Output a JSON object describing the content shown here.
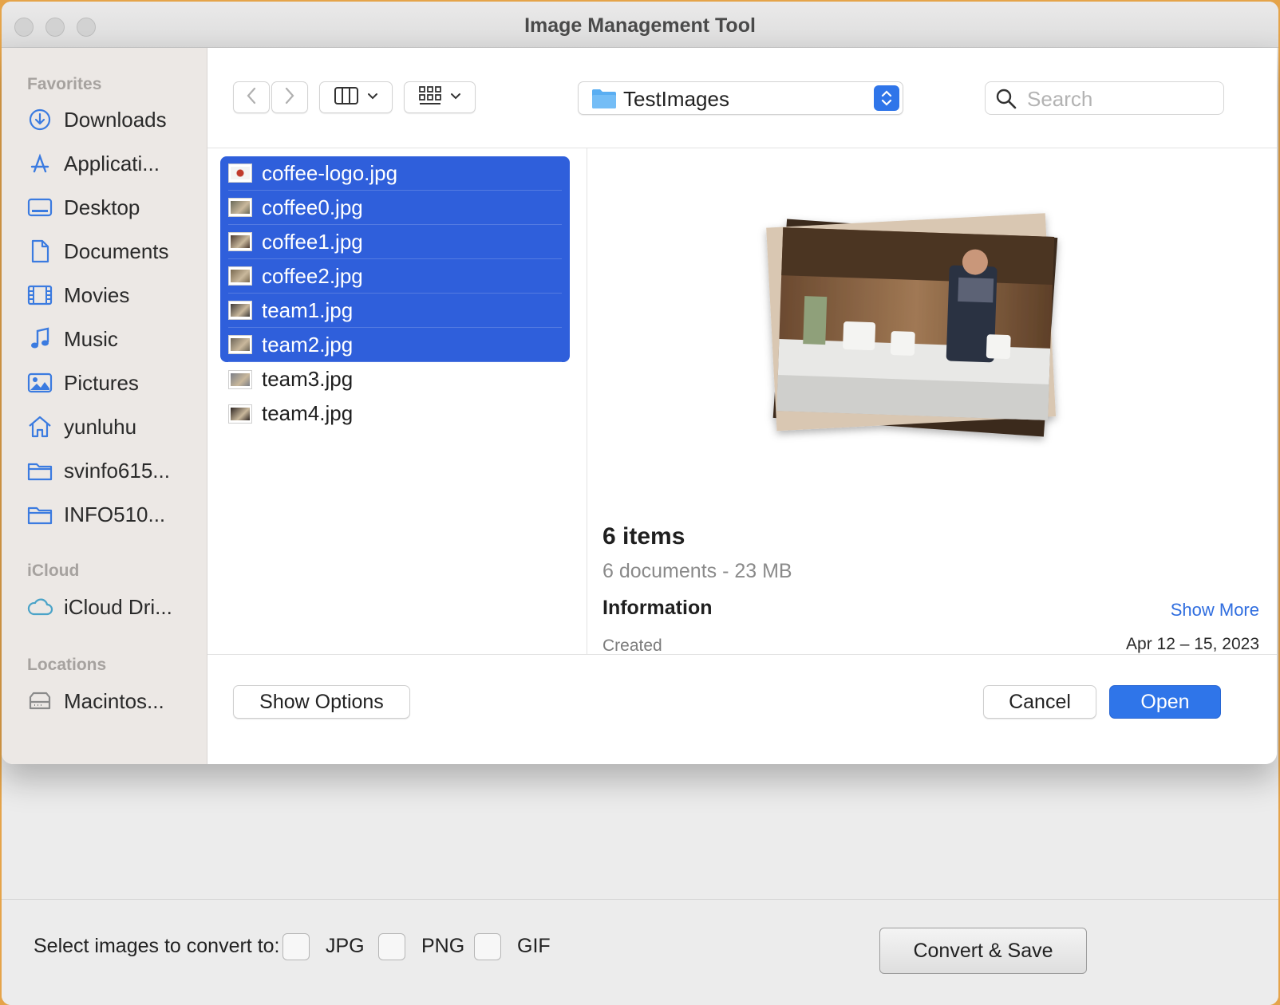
{
  "window": {
    "title": "Image Management Tool"
  },
  "sidebar": {
    "favorites_title": "Favorites",
    "favorites": [
      {
        "label": "Downloads",
        "icon": "download-circle-icon"
      },
      {
        "label": "Applicati...",
        "icon": "applications-icon"
      },
      {
        "label": "Desktop",
        "icon": "desktop-icon"
      },
      {
        "label": "Documents",
        "icon": "document-icon"
      },
      {
        "label": "Movies",
        "icon": "film-icon"
      },
      {
        "label": "Music",
        "icon": "music-note-icon"
      },
      {
        "label": "Pictures",
        "icon": "photo-icon"
      },
      {
        "label": "yunluhu",
        "icon": "home-icon"
      },
      {
        "label": "svinfo615...",
        "icon": "folder-icon"
      },
      {
        "label": "INFO510...",
        "icon": "folder-icon"
      }
    ],
    "icloud_title": "iCloud",
    "icloud": [
      {
        "label": "iCloud Dri...",
        "icon": "cloud-icon"
      }
    ],
    "locations_title": "Locations",
    "locations": [
      {
        "label": "Macintos...",
        "icon": "disk-icon"
      }
    ]
  },
  "toolbar": {
    "location": "TestImages",
    "search_placeholder": "Search"
  },
  "files": [
    {
      "name": "coffee-logo.jpg",
      "selected": true
    },
    {
      "name": "coffee0.jpg",
      "selected": true
    },
    {
      "name": "coffee1.jpg",
      "selected": true
    },
    {
      "name": "coffee2.jpg",
      "selected": true
    },
    {
      "name": "team1.jpg",
      "selected": true
    },
    {
      "name": "team2.jpg",
      "selected": true
    },
    {
      "name": "team3.jpg",
      "selected": false
    },
    {
      "name": "team4.jpg",
      "selected": false
    }
  ],
  "preview": {
    "title": "6 items",
    "subtitle": "6 documents - 23 MB",
    "info_heading": "Information",
    "show_more": "Show More",
    "created_label": "Created",
    "created_value": "Apr 12 – 15, 2023"
  },
  "dialog_buttons": {
    "show_options": "Show Options",
    "cancel": "Cancel",
    "open": "Open"
  },
  "converter": {
    "label": "Select images to convert to:",
    "formats": [
      "JPG",
      "PNG",
      "GIF"
    ],
    "button": "Convert & Save"
  },
  "colors": {
    "accent": "#2f75e9",
    "selection": "#2f5fdb",
    "sidebar_icon": "#3b7be0"
  }
}
